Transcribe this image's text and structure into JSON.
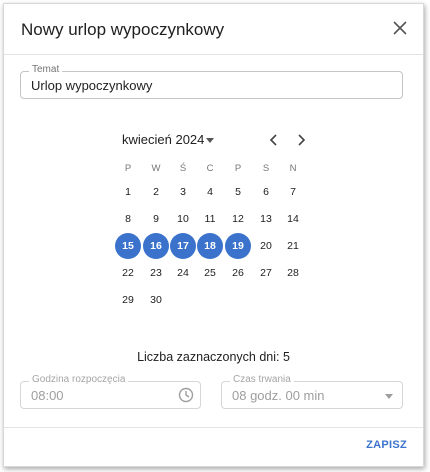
{
  "dialog": {
    "title": "Nowy urlop wypoczynkowy",
    "close_icon": "close-icon"
  },
  "topic": {
    "label": "Temat",
    "value": "Urlop wypoczynkowy"
  },
  "calendar": {
    "month_label": "kwiecień 2024",
    "weekdays": [
      "P",
      "W",
      "Ś",
      "C",
      "P",
      "S",
      "N"
    ],
    "weeks": [
      [
        "",
        "",
        "",
        "",
        "",
        "",
        ""
      ],
      [
        "1",
        "2",
        "3",
        "4",
        "5",
        "6",
        "7"
      ],
      [
        "8",
        "9",
        "10",
        "11",
        "12",
        "13",
        "14"
      ],
      [
        "15",
        "16",
        "17",
        "18",
        "19",
        "20",
        "21"
      ],
      [
        "22",
        "23",
        "24",
        "25",
        "26",
        "27",
        "28"
      ],
      [
        "29",
        "30",
        "",
        "",
        "",
        "",
        ""
      ]
    ],
    "selected_days": [
      "15",
      "16",
      "17",
      "18",
      "19"
    ],
    "selected_color": "#3b73cc"
  },
  "summary": {
    "text": "Liczba zaznaczonych dni: 5"
  },
  "start_time": {
    "label": "Godzina rozpoczęcia",
    "value": "08:00",
    "icon": "clock-icon"
  },
  "duration": {
    "label": "Czas trwania",
    "value": "08 godz. 00 min",
    "icon": "dropdown-arrow-icon"
  },
  "footer": {
    "save_label": "ZAPISZ"
  }
}
